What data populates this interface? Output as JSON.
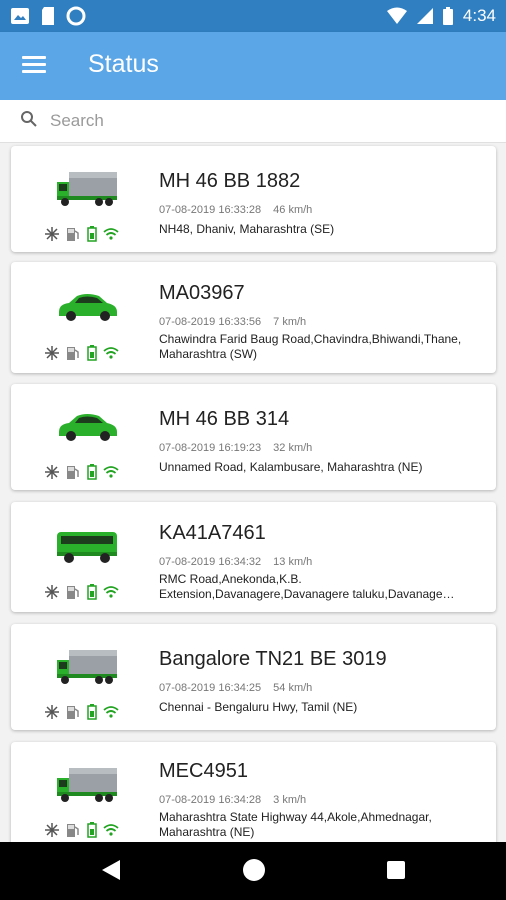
{
  "status_bar": {
    "time": "4:34"
  },
  "app_bar": {
    "title": "Status"
  },
  "search": {
    "placeholder": "Search"
  },
  "vehicles": [
    {
      "name": "MH 46 BB 1882",
      "datetime": "07-08-2019 16:33:28",
      "speed": "46 km/h",
      "address": "NH48,  Dhaniv, Maharashtra (SE)",
      "type": "truck"
    },
    {
      "name": "MA03967",
      "datetime": "07-08-2019 16:33:56",
      "speed": "7 km/h",
      "address": "Chawindra Farid Baug Road,Chavindra,Bhiwandi,Thane, Maharashtra (SW)",
      "type": "car"
    },
    {
      "name": "MH 46 BB 314",
      "datetime": "07-08-2019 16:19:23",
      "speed": "32 km/h",
      "address": "Unnamed Road, Kalambusare, Maharashtra (NE)",
      "type": "car"
    },
    {
      "name": "KA41A7461",
      "datetime": "07-08-2019 16:34:32",
      "speed": "13 km/h",
      "address": "RMC Road,Anekonda,K.B. Extension,Davanagere,Davanagere taluku,Davanage…",
      "type": "bus"
    },
    {
      "name": "Bangalore TN21 BE 3019",
      "datetime": "07-08-2019 16:34:25",
      "speed": "54 km/h",
      "address": "Chennai - Bengaluru Hwy, Tamil (NE)",
      "type": "truck"
    },
    {
      "name": "MEC4951",
      "datetime": "07-08-2019 16:34:28",
      "speed": "3 km/h",
      "address": "Maharashtra State Highway 44,Akole,Ahmednagar, Maharashtra (NE)",
      "type": "truck"
    }
  ],
  "colors": {
    "status_bar": "#2f7fc1",
    "app_bar": "#5aa6e6",
    "vehicle_green": "#2bb02b",
    "battery_green": "#22a322",
    "wifi_green": "#22a322"
  },
  "icons": [
    "menu-icon",
    "search-icon",
    "snowflake-icon",
    "fuel-pump-icon",
    "battery-icon",
    "wifi-icon",
    "back-icon",
    "home-icon",
    "recents-icon"
  ]
}
